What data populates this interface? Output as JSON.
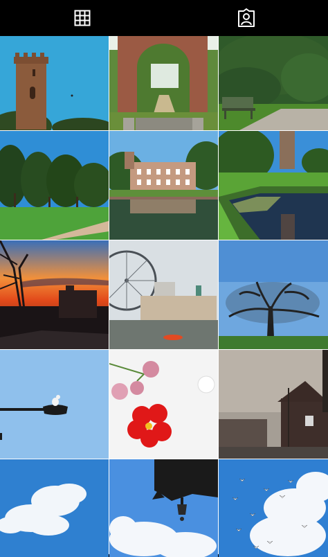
{
  "tabs": [
    {
      "label": "Posts grid",
      "icon": "grid-icon",
      "active": true
    },
    {
      "label": "Tagged",
      "icon": "tagged-person-icon",
      "active": false
    }
  ],
  "photos": [
    {
      "subject": "stone-tower"
    },
    {
      "subject": "garden-archway"
    },
    {
      "subject": "park-bench-under-cedar"
    },
    {
      "subject": "tree-line-park"
    },
    {
      "subject": "manor-reflection-pond"
    },
    {
      "subject": "lily-pond-tower"
    },
    {
      "subject": "sunset-silhouette"
    },
    {
      "subject": "london-eye-riverside"
    },
    {
      "subject": "lone-oak-tree"
    },
    {
      "subject": "bird-on-streetlamp"
    },
    {
      "subject": "red-flower-petals"
    },
    {
      "subject": "foggy-street"
    },
    {
      "subject": "blue-sky-cloud"
    },
    {
      "subject": "pagoda-roof-sky"
    },
    {
      "subject": "birds-in-sky"
    }
  ],
  "colors": {
    "bar": "#000000",
    "icon": "#ffffff",
    "divider": "#ffffff"
  }
}
